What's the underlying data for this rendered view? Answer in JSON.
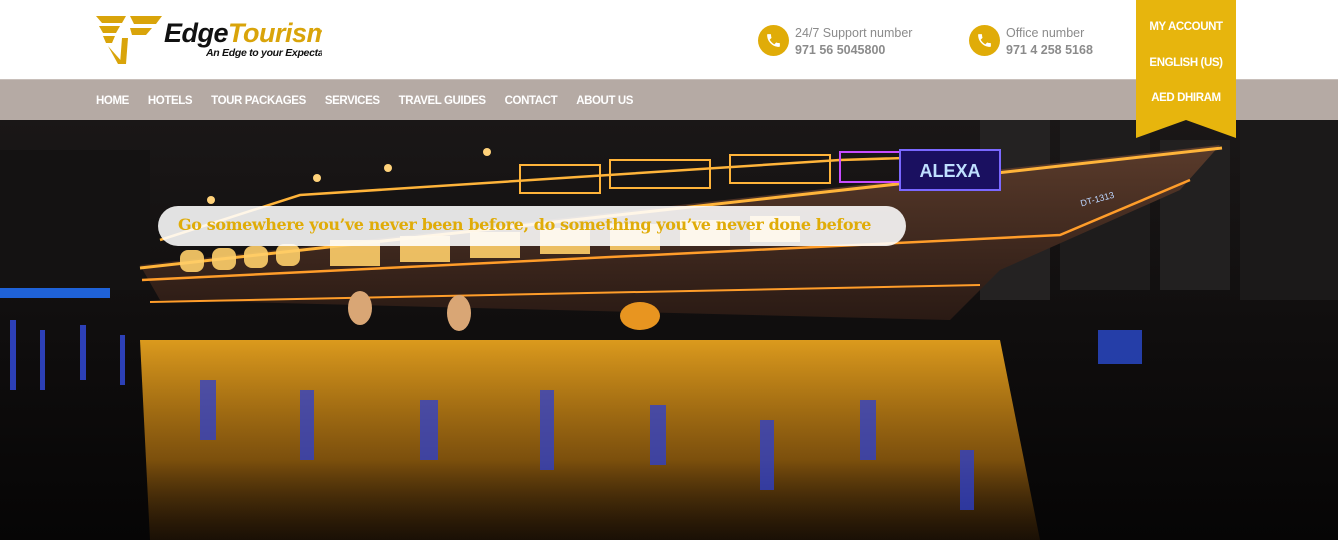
{
  "brand": {
    "name_part1": "Edge",
    "name_part2": "Tourism",
    "tagline": "An Edge to your Expectations",
    "accent_color": "#e0ac08"
  },
  "header": {
    "support": {
      "label": "24/7 Support number",
      "value": "971 56 5045800",
      "icon": "phone-icon"
    },
    "office": {
      "label": "Office number",
      "value": "971 4 258 5168",
      "icon": "phone-icon"
    }
  },
  "nav": {
    "items": [
      "HOME",
      "HOTELS",
      "TOUR PACKAGES",
      "SERVICES",
      "TRAVEL GUIDES",
      "CONTACT",
      "ABOUT US"
    ]
  },
  "account_menu": {
    "my_account": "MY ACCOUNT",
    "language": "ENGLISH (US)",
    "currency": "AED DHIRAM"
  },
  "hero": {
    "tagline": "Go somewhere you’ve never been before, do something you’ve never done before",
    "boat_sign": "ALEXA",
    "boat_number": "DT-1313"
  }
}
